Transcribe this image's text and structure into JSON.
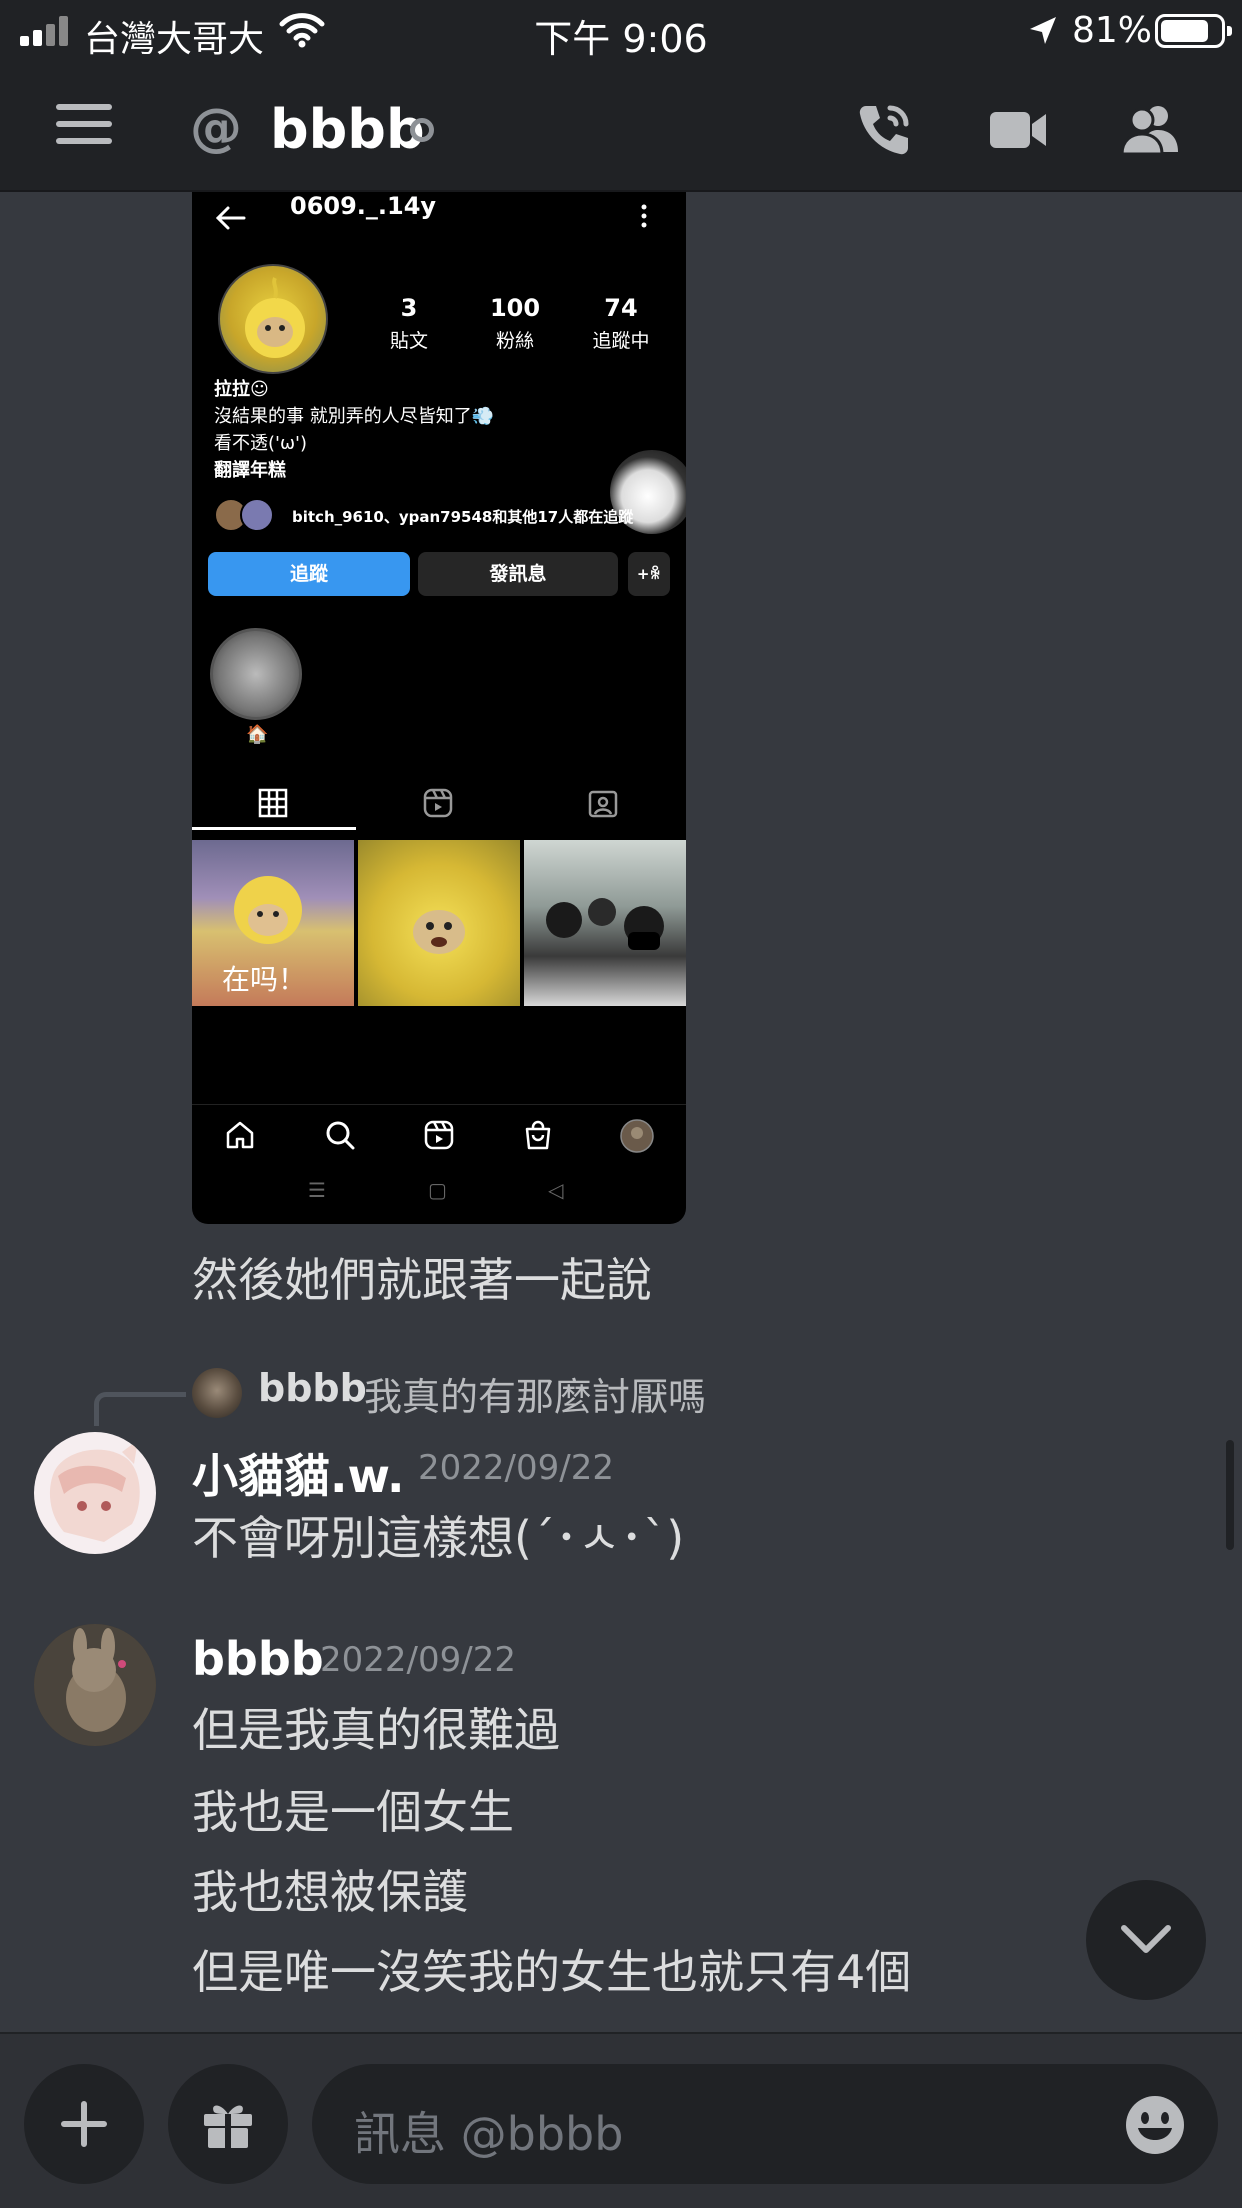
{
  "status_bar": {
    "carrier": "台灣大哥大",
    "time": "下午 9:06",
    "battery_percent": "81%",
    "battery_level": 0.81
  },
  "header": {
    "at_symbol": "@",
    "name": "bbbb"
  },
  "embedded_screenshot": {
    "username": "0609._.14y",
    "stats": [
      {
        "number": "3",
        "label": "貼文"
      },
      {
        "number": "100",
        "label": "粉絲"
      },
      {
        "number": "74",
        "label": "追蹤中"
      }
    ],
    "bio": [
      "拉拉☺",
      "沒結果的事 就別弄的人尽皆知了💨",
      "看不透(ꞌωꞌ)",
      "翻譯年糕"
    ],
    "followed_by": "bitch_9610、ypan79548和其他17人都在追蹤",
    "follow_button": "追蹤",
    "message_button": "發訊息",
    "add_button": "+ꆜ",
    "highlight_emoji": "🏠",
    "grid_caption": "在吗！",
    "android_nav": [
      "☰",
      "▢",
      "◁"
    ]
  },
  "messages": {
    "first_caption": "然後她們就跟著一起說",
    "reply": {
      "author": "bbbb",
      "text": "我真的有那麼討厭嗎"
    },
    "group1": {
      "author": "小貓貓.w.",
      "timestamp": "2022/09/22",
      "lines": [
        "不會呀別這樣想(´･ㅅ･`)"
      ]
    },
    "group2": {
      "author": "bbbb",
      "timestamp": "2022/09/22",
      "lines": [
        "但是我真的很難過",
        "我也是一個女生",
        "我也想被保護",
        "但是唯一沒笑我的女生也就只有4個"
      ]
    }
  },
  "composer": {
    "placeholder": "訊息 @bbbb"
  },
  "icons": {
    "signal": "cellular-signal-icon",
    "wifi": "wifi-icon",
    "location": "location-arrow-icon",
    "menu": "hamburger-menu-icon",
    "call": "phone-call-icon",
    "video": "video-camera-icon",
    "members": "members-icon",
    "add": "plus-icon",
    "gift": "gift-icon",
    "emoji": "emoji-icon",
    "jump": "chevron-down-icon"
  },
  "colors": {
    "background": "#36393f",
    "header": "#202225",
    "composer": "#2f3136",
    "instagram_blue": "#3897f0"
  }
}
